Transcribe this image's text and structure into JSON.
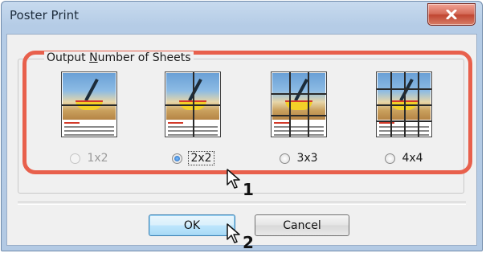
{
  "window": {
    "title": "Poster Print",
    "close_icon": "close-icon"
  },
  "group": {
    "label_prefix": "Output ",
    "label_accel": "N",
    "label_suffix": "umber of Sheets"
  },
  "options": [
    {
      "label": "1x2",
      "enabled": false,
      "selected": false,
      "cols": 1,
      "rows": 2
    },
    {
      "label": "2x2",
      "enabled": true,
      "selected": true,
      "cols": 2,
      "rows": 2
    },
    {
      "label": "3x3",
      "enabled": true,
      "selected": false,
      "cols": 3,
      "rows": 3
    },
    {
      "label": "4x4",
      "enabled": true,
      "selected": false,
      "cols": 4,
      "rows": 4
    }
  ],
  "buttons": {
    "ok": "OK",
    "cancel": "Cancel"
  },
  "callouts": {
    "step1": "1",
    "step2": "2"
  },
  "colors": {
    "highlight": "#e8604c",
    "default_button_border": "#3c7fb1"
  }
}
